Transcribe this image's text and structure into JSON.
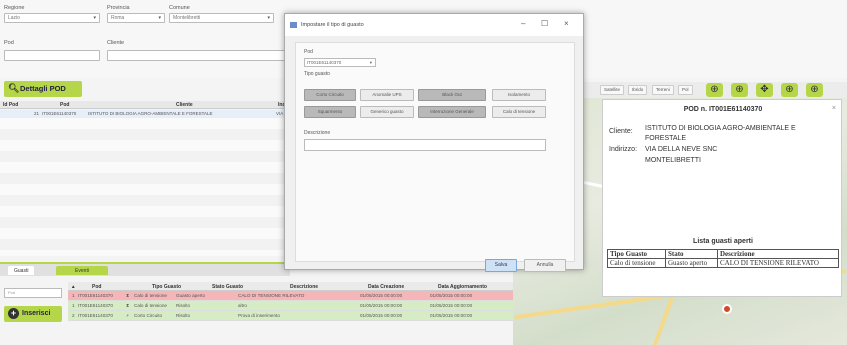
{
  "filters": {
    "regione_label": "Regione",
    "regione_value": "Lazio",
    "provincia_label": "Provincia",
    "provincia_value": "Roma",
    "comune_label": "Comune",
    "comune_value": "Montelibretti",
    "pod_label": "Pod",
    "pod_value": "",
    "cliente_label": "Cliente",
    "cliente_value": ""
  },
  "dettagli_button": "Dettagli POD",
  "pod_table": {
    "headers": [
      "Id Pod",
      "Pod",
      "Cliente",
      "Ind"
    ],
    "row": [
      "21",
      "IT001E61140370",
      "ISTITUTO DI BIOLOGIA AGRO-AMBIENTALE E FORESTALE",
      "VIA"
    ]
  },
  "tabs": [
    "Guasti",
    "Eventi"
  ],
  "pod_filter_placeholder": "Pod",
  "inserisci_button": "Inserisci",
  "guasti_table": {
    "headers": [
      "Pod",
      "Tipo Guasto",
      "Stato Guasto",
      "Descrizione",
      "Data Creazione",
      "Data Aggiornamento"
    ],
    "rows": [
      {
        "n": "1",
        "pod": "IT001E61140370",
        "tipo": "Calo di tensione",
        "stato": "Guasto aperto",
        "descr": "CALO DI TENSIONE RILEVATO",
        "creazione": "01/05/2015 00:00:00",
        "aggiornamento": "01/05/2015 00:00:00",
        "color": "red"
      },
      {
        "n": "1",
        "pod": "IT001E61140370",
        "tipo": "Calo di tensione",
        "stato": "Risolto",
        "descr": "altro",
        "creazione": "01/05/2015 00:00:00",
        "aggiornamento": "01/05/2015 00:00:00",
        "color": "green"
      },
      {
        "n": "2",
        "pod": "IT001E61140370",
        "tipo": "Corto Circuito",
        "stato": "Risolto",
        "descr": "Prova di inserimento",
        "creazione": "01/05/2015 00:00:00",
        "aggiornamento": "01/05/2015 00:00:00",
        "color": "green"
      }
    ]
  },
  "map_toolbar": {
    "buttons": [
      "Satellite",
      "Ibrido",
      "Terreni",
      "Pol"
    ],
    "icons": [
      "target-icon",
      "target-icon",
      "move-icon",
      "target-icon",
      "target-icon"
    ]
  },
  "pod_popup": {
    "title": "POD n. IT001E61140370",
    "cliente_label": "Cliente:",
    "cliente_value_1": "ISTITUTO DI BIOLOGIA AGRO-AMBIENTALE E",
    "cliente_value_2": "FORESTALE",
    "indirizzo_label": "Indirizzo:",
    "indirizzo_value_1": "VIA DELLA NEVE SNC",
    "indirizzo_value_2": "MONTELIBRETTI",
    "list_title": "Lista guasti aperti",
    "list_headers": [
      "Tipo Guasto",
      "Stato",
      "Descrizione"
    ],
    "list_row": [
      "Calo di tensione",
      "Guasto aperto",
      "CALO DI TENSIONE RILEVATO"
    ]
  },
  "dialog": {
    "title": "Impostare il tipo di guasto",
    "pod_label": "Pod",
    "pod_value": "IT001E61140370",
    "tipo_label": "Tipo guasto",
    "types_row1": [
      "Corto Circuito",
      "Anomalie UPS",
      "Black Out",
      "Isolamento"
    ],
    "types_row2": [
      "Squarmento",
      "Generico guasto",
      "Interruzione Generale",
      "Calo di tensione"
    ],
    "selected": [
      "Corto Circuito",
      "Black Out",
      "Squarmento",
      "Interruzione Generale"
    ],
    "descrizione_label": "Descrizione",
    "salva": "Salva",
    "annulla": "Annulla"
  },
  "colors": {
    "accent": "#b6d64a",
    "error_row": "#f4b6b6",
    "ok_row": "#d6ecc4"
  }
}
